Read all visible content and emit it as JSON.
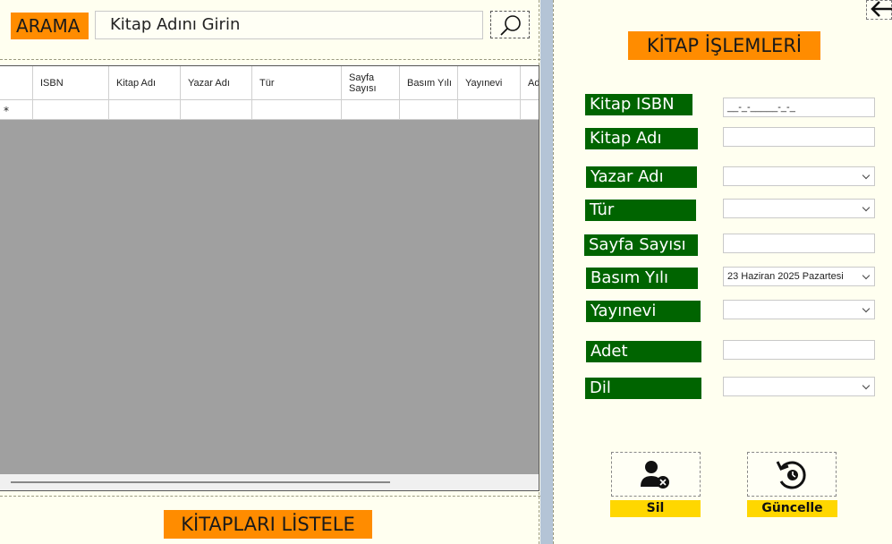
{
  "search": {
    "label": "ARAMA",
    "placeholder": "Kitap Adını Girin",
    "button_icon": "search-icon"
  },
  "grid": {
    "row_marker": "*",
    "columns": [
      "ISBN",
      "Kitap Adı",
      "Yazar Adı",
      "Tür",
      "Sayfa Sayısı",
      "Basım Yılı",
      "Yayınevi",
      "Ad"
    ]
  },
  "list_button": "KİTAPLARI LİSTELE",
  "form": {
    "title": "KİTAP İŞLEMLERİ",
    "labels": {
      "isbn": "Kitap ISBN",
      "name": "Kitap Adı",
      "author": "Yazar Adı",
      "genre": "Tür",
      "pages": "Sayfa Sayısı",
      "year": "Basım Yılı",
      "publisher": "Yayınevi",
      "count": "Adet",
      "language": "Dil"
    },
    "values": {
      "isbn_mask": "__-_-_____-_-_",
      "year": "23  Haziran  2025  Pazartesi"
    }
  },
  "actions": {
    "delete": "Sil",
    "update": "Güncelle"
  },
  "colors": {
    "orange": "#ff8c00",
    "green": "#006400",
    "yellow": "#ffd700",
    "background": "#fffff0"
  }
}
